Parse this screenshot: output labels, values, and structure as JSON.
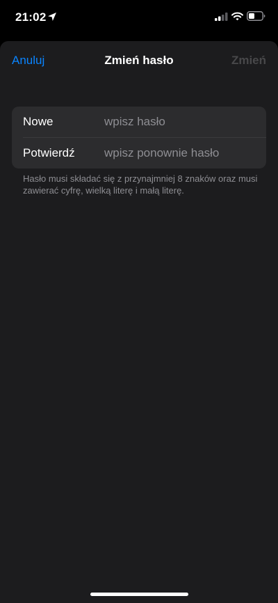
{
  "status_bar": {
    "time": "21:02",
    "location_icon": "location-arrow-icon",
    "signal_icon": "cellular-signal-icon",
    "wifi_icon": "wifi-icon",
    "battery_icon": "battery-icon"
  },
  "nav": {
    "cancel_label": "Anuluj",
    "title": "Zmień hasło",
    "confirm_label": "Zmień"
  },
  "form": {
    "rows": [
      {
        "label": "Nowe",
        "placeholder": "wpisz hasło",
        "value": ""
      },
      {
        "label": "Potwierdź",
        "placeholder": "wpisz ponownie hasło",
        "value": ""
      }
    ]
  },
  "hint": "Hasło musi składać się z przynajmniej 8 znaków oraz musi zawierać cyfrę, wielką literę i małą literę.",
  "colors": {
    "accent": "#0a84ff",
    "sheet_background": "#1c1c1e",
    "group_background": "#2c2c2e",
    "disabled_text": "#48484a",
    "secondary_text": "#8e8e93"
  }
}
